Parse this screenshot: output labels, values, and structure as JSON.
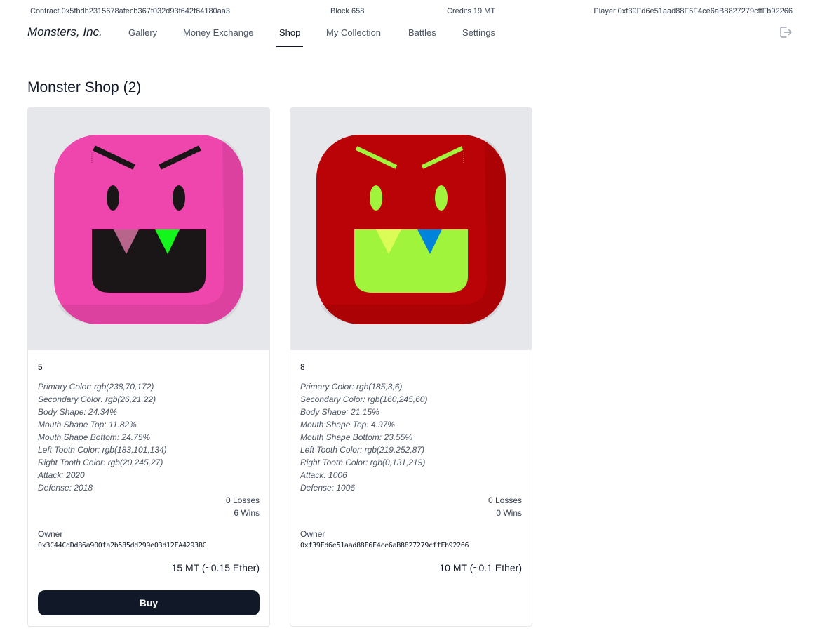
{
  "topbar": {
    "contract": "Contract 0x5fbdb2315678afecb367f032d93f642f64180aa3",
    "block": "Block 658",
    "credits": "Credits 19 MT",
    "player": "Player 0xf39Fd6e51aad88F6F4ce6aB8827279cffFb92266"
  },
  "nav": {
    "brand": "Monsters, Inc.",
    "items": [
      "Gallery",
      "Money Exchange",
      "Shop",
      "My Collection",
      "Battles",
      "Settings"
    ],
    "active": "Shop",
    "logout_icon": "logout-icon"
  },
  "page": {
    "title": "Monster Shop (2)"
  },
  "monsters": [
    {
      "id": "5",
      "colors": {
        "primary": "#ee46ac",
        "secondary": "#1a1516",
        "left_tooth": "#b7658a",
        "right_tooth": "#14f51b"
      },
      "attributes": [
        "Primary Color: rgb(238,70,172)",
        "Secondary Color: rgb(26,21,22)",
        "Body Shape: 24.34%",
        "Mouth Shape Top: 11.82%",
        "Mouth Shape Bottom: 24.75%",
        "Left Tooth Color: rgb(183,101,134)",
        "Right Tooth Color: rgb(20,245,27)",
        "Attack: 2020",
        "Defense: 2018"
      ],
      "losses": "0 Losses",
      "wins": "6 Wins",
      "owner_label": "Owner",
      "owner": "0x3C44CdDdB6a900fa2b585dd299e03d12FA4293BC",
      "price": "15 MT (~0.15 Ether)",
      "buy_label": "Buy"
    },
    {
      "id": "8",
      "colors": {
        "primary": "#b90306",
        "secondary": "#a0f53c",
        "left_tooth": "#dbfc57",
        "right_tooth": "#0083db"
      },
      "attributes": [
        "Primary Color: rgb(185,3,6)",
        "Secondary Color: rgb(160,245,60)",
        "Body Shape: 21.15%",
        "Mouth Shape Top: 4.97%",
        "Mouth Shape Bottom: 23.55%",
        "Left Tooth Color: rgb(219,252,87)",
        "Right Tooth Color: rgb(0,131,219)",
        "Attack: 1006",
        "Defense: 1006"
      ],
      "losses": "0 Losses",
      "wins": "0 Wins",
      "owner_label": "Owner",
      "owner": "0xf39Fd6e51aad88F6F4ce6aB8827279cffFb92266",
      "price": "10 MT (~0.1 Ether)"
    }
  ]
}
